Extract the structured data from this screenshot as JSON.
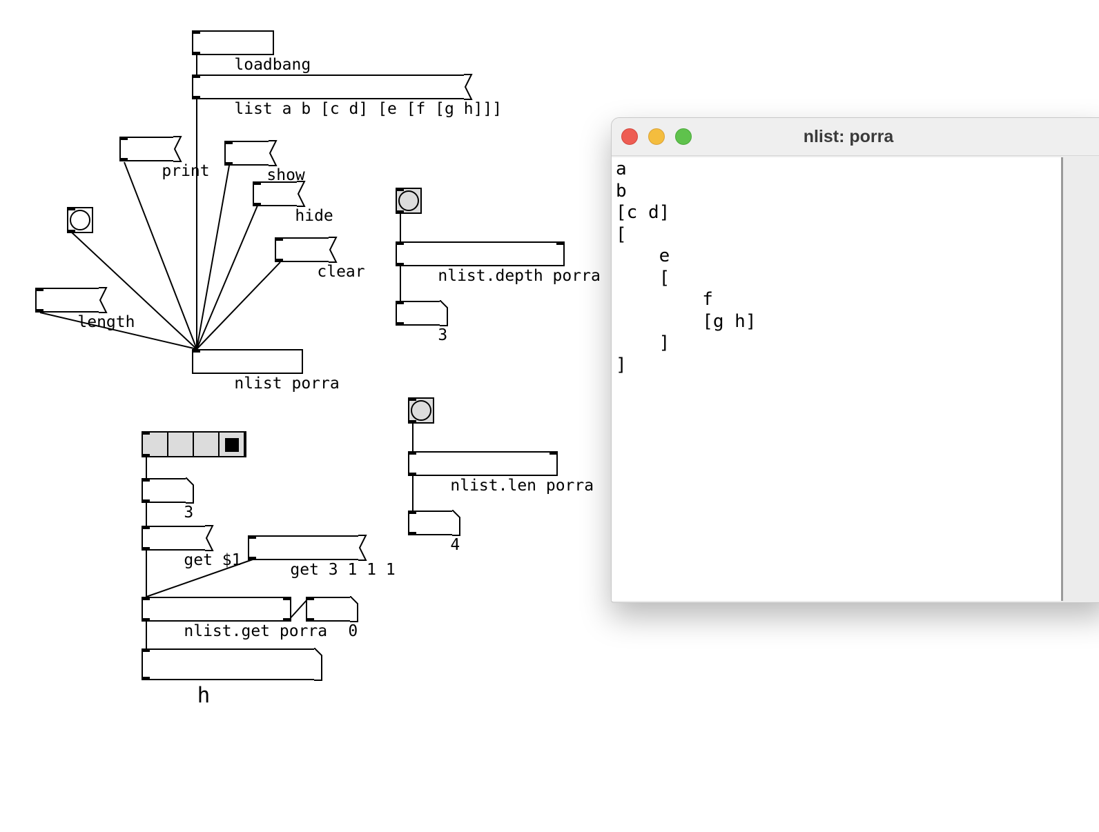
{
  "patch": {
    "objects": {
      "loadbang": "loadbang",
      "nlist": "nlist porra",
      "nlist_depth": "nlist.depth porra",
      "nlist_len": "nlist.len porra",
      "nlist_get": "nlist.get porra"
    },
    "messages": {
      "list": "list a b [c d] [e [f [g h]]]",
      "print": "print",
      "show": "show",
      "hide": "hide",
      "clear": "clear",
      "length": "length",
      "get_var": "get $1",
      "get_path": "get 3 1 1 1"
    },
    "numbers": {
      "depth_out": "3",
      "len_out": "4",
      "radio_value": "3",
      "get_right_out": "0"
    },
    "symbol_out": "h",
    "radio": {
      "cells": 4,
      "selected_index": 3
    }
  },
  "window": {
    "title": "nlist: porra",
    "lines": [
      "a",
      "b",
      "[c d]",
      "[",
      "    e",
      "    [",
      "        f",
      "        [g h]",
      "    ]",
      "]"
    ]
  }
}
